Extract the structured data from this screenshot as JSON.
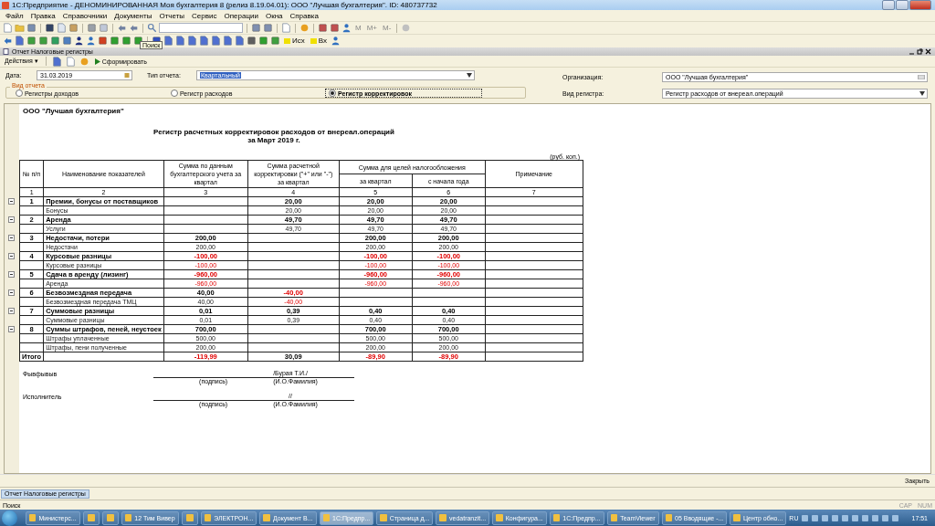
{
  "window": {
    "title": "1С:Предприятие - ДЕНОМИНИРОВАННАЯ Моя бухгалтерия 8 (релиз 8.19.04.01): ООО \"Лучшая бухгалтерия\". ID: 480737732"
  },
  "menu": [
    "Файл",
    "Правка",
    "Справочники",
    "Документы",
    "Отчеты",
    "Сервис",
    "Операции",
    "Окна",
    "Справка"
  ],
  "toolbar": {
    "memory_labels": [
      "M",
      "M+",
      "M-"
    ],
    "tags": [
      "Исх",
      "Вх"
    ],
    "tooltip": "Поиск"
  },
  "child_window": {
    "title": "Отчет  Налоговые регистры"
  },
  "actions": {
    "menu": "Действия",
    "menu_caret": "▾",
    "generate": "Сформировать"
  },
  "form": {
    "date_label": "Дата:",
    "date": "31.03.2019",
    "type_label": "Тип отчета:",
    "type": "Квартальный",
    "org_label": "Организация:",
    "org": "ООО \"Лучшая бухгалтерия\"",
    "group_label": "Вид отчета",
    "register_label": "Вид регистра:",
    "register": "Регистр расходов от внереал.операций",
    "options": [
      {
        "label": "Регистры доходов",
        "selected": false
      },
      {
        "label": "Регистр расходов",
        "selected": false
      },
      {
        "label": "Регистр корректировок",
        "selected": true
      }
    ]
  },
  "report": {
    "company": "ООО \"Лучшая бухгалтерия\"",
    "title": "Регистр расчетных корректировок расходов от внереал.операций",
    "subtitle": "за Март 2019 г.",
    "units": "(руб. коп.)",
    "headers": {
      "no": "№ п/п",
      "name": "Наименование показателей",
      "col3": "Сумма по данным бухгалтерского учета за квартал",
      "col4": "Сумма расчетной корректировки (\"+\" или \"-\") за квартал",
      "tax": "Сумма для целей налогообложения",
      "col5": "за квартал",
      "col6": "с начала года",
      "note": "Примечание"
    },
    "numbers": [
      "1",
      "2",
      "3",
      "4",
      "5",
      "6",
      "7"
    ],
    "rows": [
      {
        "kind": "group",
        "cells": [
          {
            "text": "1"
          },
          {
            "text": "Премии, бонусы от поставщиков"
          },
          {
            "text": ""
          },
          {
            "text": "20,00",
            "negative": false
          },
          {
            "text": "20,00",
            "negative": false
          },
          {
            "text": "20,00",
            "negative": false
          },
          {
            "text": ""
          }
        ],
        "children": [
          {
            "kind": "item",
            "cells": [
              {
                "text": ""
              },
              {
                "text": "Бонусы"
              },
              {
                "text": ""
              },
              {
                "text": "20,00",
                "negative": false
              },
              {
                "text": "20,00",
                "negative": false
              },
              {
                "text": "20,00",
                "negative": false
              },
              {
                "text": ""
              }
            ]
          }
        ]
      },
      {
        "kind": "group",
        "cells": [
          {
            "text": "2"
          },
          {
            "text": "Аренда"
          },
          {
            "text": ""
          },
          {
            "text": "49,70",
            "negative": false
          },
          {
            "text": "49,70",
            "negative": false
          },
          {
            "text": "49,70",
            "negative": false
          },
          {
            "text": ""
          }
        ],
        "children": [
          {
            "kind": "item",
            "cells": [
              {
                "text": ""
              },
              {
                "text": "Услуги"
              },
              {
                "text": ""
              },
              {
                "text": "49,70",
                "negative": false
              },
              {
                "text": "49,70",
                "negative": false
              },
              {
                "text": "49,70",
                "negative": false
              },
              {
                "text": ""
              }
            ]
          }
        ]
      },
      {
        "kind": "group",
        "cells": [
          {
            "text": "3"
          },
          {
            "text": "Недостачи, потери"
          },
          {
            "text": "200,00",
            "negative": false
          },
          {
            "text": ""
          },
          {
            "text": "200,00",
            "negative": false
          },
          {
            "text": "200,00",
            "negative": false
          },
          {
            "text": ""
          }
        ],
        "children": [
          {
            "kind": "item",
            "cells": [
              {
                "text": ""
              },
              {
                "text": "Недостачи"
              },
              {
                "text": "200,00",
                "negative": false
              },
              {
                "text": ""
              },
              {
                "text": "200,00",
                "negative": false
              },
              {
                "text": "200,00",
                "negative": false
              },
              {
                "text": ""
              }
            ]
          }
        ]
      },
      {
        "kind": "group",
        "cells": [
          {
            "text": "4"
          },
          {
            "text": "Курсовые разницы"
          },
          {
            "text": "-100,00",
            "negative": true
          },
          {
            "text": ""
          },
          {
            "text": "-100,00",
            "negative": true
          },
          {
            "text": "-100,00",
            "negative": true
          },
          {
            "text": ""
          }
        ],
        "children": [
          {
            "kind": "item",
            "cells": [
              {
                "text": ""
              },
              {
                "text": "Курсовые разницы"
              },
              {
                "text": "-100,00",
                "negative": true
              },
              {
                "text": ""
              },
              {
                "text": "-100,00",
                "negative": true
              },
              {
                "text": "-100,00",
                "negative": true
              },
              {
                "text": ""
              }
            ]
          }
        ]
      },
      {
        "kind": "group",
        "cells": [
          {
            "text": "5"
          },
          {
            "text": "Сдача в аренду (лизинг)"
          },
          {
            "text": "-960,00",
            "negative": true
          },
          {
            "text": ""
          },
          {
            "text": "-960,00",
            "negative": true
          },
          {
            "text": "-960,00",
            "negative": true
          },
          {
            "text": ""
          }
        ],
        "children": [
          {
            "kind": "item",
            "cells": [
              {
                "text": ""
              },
              {
                "text": "Аренда"
              },
              {
                "text": "-960,00",
                "negative": true
              },
              {
                "text": ""
              },
              {
                "text": "-960,00",
                "negative": true
              },
              {
                "text": "-960,00",
                "negative": true
              },
              {
                "text": ""
              }
            ]
          }
        ]
      },
      {
        "kind": "group",
        "cells": [
          {
            "text": "6"
          },
          {
            "text": "Безвозмездная передача"
          },
          {
            "text": "40,00",
            "negative": false
          },
          {
            "text": "-40,00",
            "negative": true
          },
          {
            "text": ""
          },
          {
            "text": ""
          },
          {
            "text": ""
          }
        ],
        "children": [
          {
            "kind": "item",
            "cells": [
              {
                "text": ""
              },
              {
                "text": "Безвозмездная передача ТМЦ"
              },
              {
                "text": "40,00",
                "negative": false
              },
              {
                "text": "-40,00",
                "negative": true
              },
              {
                "text": ""
              },
              {
                "text": ""
              },
              {
                "text": ""
              }
            ]
          }
        ]
      },
      {
        "kind": "group",
        "cells": [
          {
            "text": "7"
          },
          {
            "text": "Суммовые разницы"
          },
          {
            "text": "0,01",
            "negative": false
          },
          {
            "text": "0,39",
            "negative": false
          },
          {
            "text": "0,40",
            "negative": false
          },
          {
            "text": "0,40",
            "negative": false
          },
          {
            "text": ""
          }
        ],
        "children": [
          {
            "kind": "item",
            "cells": [
              {
                "text": ""
              },
              {
                "text": "Суммовые разницы"
              },
              {
                "text": "0,01",
                "negative": false
              },
              {
                "text": "0,39",
                "negative": false
              },
              {
                "text": "0,40",
                "negative": false
              },
              {
                "text": "0,40",
                "negative": false
              },
              {
                "text": ""
              }
            ]
          }
        ]
      },
      {
        "kind": "group",
        "cells": [
          {
            "text": "8"
          },
          {
            "text": "Суммы штрафов, пеней, неустоек"
          },
          {
            "text": "700,00",
            "negative": false
          },
          {
            "text": ""
          },
          {
            "text": "700,00",
            "negative": false
          },
          {
            "text": "700,00",
            "negative": false
          },
          {
            "text": ""
          }
        ],
        "children": [
          {
            "kind": "item",
            "cells": [
              {
                "text": ""
              },
              {
                "text": "Штрафы уплаченные"
              },
              {
                "text": "500,00",
                "negative": false
              },
              {
                "text": ""
              },
              {
                "text": "500,00",
                "negative": false
              },
              {
                "text": "500,00",
                "negative": false
              },
              {
                "text": ""
              }
            ]
          },
          {
            "kind": "item",
            "cells": [
              {
                "text": ""
              },
              {
                "text": "Штрафы, пени полученные"
              },
              {
                "text": "200,00",
                "negative": false
              },
              {
                "text": ""
              },
              {
                "text": "200,00",
                "negative": false
              },
              {
                "text": "200,00",
                "negative": false
              },
              {
                "text": ""
              }
            ]
          }
        ]
      },
      {
        "kind": "total",
        "cells": [
          {
            "text": "Итого"
          },
          {
            "text": ""
          },
          {
            "text": "-119,99",
            "negative": true
          },
          {
            "text": "30,09",
            "negative": false
          },
          {
            "text": "-89,90",
            "negative": true
          },
          {
            "text": "-89,90",
            "negative": true
          },
          {
            "text": ""
          }
        ]
      }
    ],
    "signatures": [
      {
        "role": "Фывфывыв",
        "value": "/Бурая Т.И./",
        "sign_hint": "(подпись)",
        "name_hint": "(И.О.Фамилия)"
      },
      {
        "role": "Исполнитель",
        "value": "//",
        "sign_hint": "(подпись)",
        "name_hint": "(И.О.Фамилия)"
      }
    ]
  },
  "bottom": {
    "close": "Закрыть",
    "window_tab": "Отчет  Налоговые регистры",
    "status": "Поиск",
    "indicators": [
      "CAP",
      "NUM"
    ]
  },
  "taskbar": {
    "items": [
      {
        "kind": "button",
        "label": "Министерс...",
        "selected": false
      },
      {
        "kind": "icon",
        "selected": false
      },
      {
        "kind": "icon",
        "selected": false
      },
      {
        "kind": "button",
        "label": "12 Тим Вивер",
        "selected": false
      },
      {
        "kind": "icon",
        "selected": false
      },
      {
        "kind": "button",
        "label": "ЭЛЕКТРОН...",
        "selected": false
      },
      {
        "kind": "button",
        "label": "Документ В...",
        "selected": false
      },
      {
        "kind": "button",
        "label": "1С:Предпр...",
        "selected": true
      },
      {
        "kind": "button",
        "label": "Страница д...",
        "selected": false
      },
      {
        "kind": "button",
        "label": "vedatranzit...",
        "selected": false
      },
      {
        "kind": "button",
        "label": "Конфигура...",
        "selected": false
      },
      {
        "kind": "button",
        "label": "1С:Предпр...",
        "selected": false
      },
      {
        "kind": "button",
        "label": "TeamViewer",
        "selected": false
      },
      {
        "kind": "button",
        "label": "05 Вводящие -...",
        "selected": false
      },
      {
        "kind": "button",
        "label": "Центр обно...",
        "selected": false
      }
    ],
    "lang": "RU",
    "clock": "17:51"
  }
}
